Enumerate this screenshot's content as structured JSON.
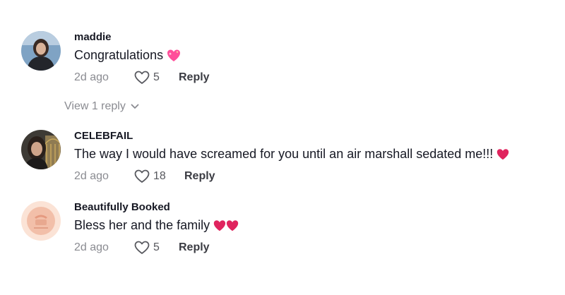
{
  "comments": [
    {
      "username": "maddie",
      "text": "Congratulations",
      "emoji": "sparkling-heart-icon",
      "time": "2d ago",
      "likes": "5",
      "reply_label": "Reply"
    },
    {
      "username": "CELEBFAIL",
      "text": "The way I would have screamed for you until an air marshall sedated me!!!",
      "emoji": "red-heart-icon",
      "time": "2d ago",
      "likes": "18",
      "reply_label": "Reply"
    },
    {
      "username": "Beautifully Booked",
      "text": "Bless her and the family",
      "emoji": "two-red-hearts-icon",
      "time": "2d ago",
      "likes": "5",
      "reply_label": "Reply"
    }
  ],
  "view_replies_label": "View 1 reply",
  "colors": {
    "text": "#161823",
    "secondary": "#8a8b91",
    "heart_red": "#e0245e",
    "sparkle_pink": "#ff4f9a"
  }
}
